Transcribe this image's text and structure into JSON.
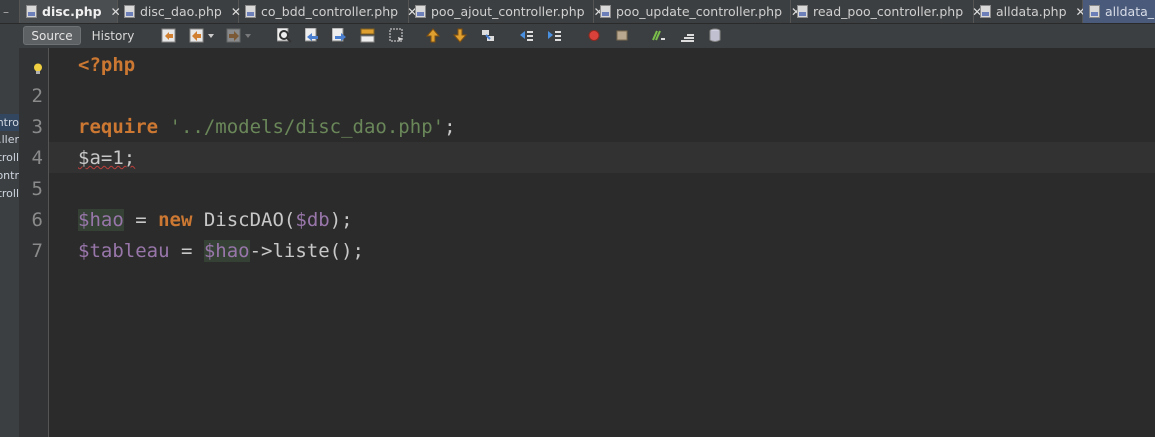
{
  "tabs": [
    {
      "label": "disc.php",
      "state": "active"
    },
    {
      "label": "disc_dao.php",
      "state": "normal"
    },
    {
      "label": "co_bdd_controller.php",
      "state": "normal"
    },
    {
      "label": "poo_ajout_controller.php",
      "state": "normal"
    },
    {
      "label": "poo_update_controller.php",
      "state": "normal"
    },
    {
      "label": "read_poo_controller.php",
      "state": "normal"
    },
    {
      "label": "alldata.php",
      "state": "normal"
    },
    {
      "label": "alldata_p",
      "state": "selected"
    }
  ],
  "tab_close_glyph": "✕",
  "tab_lead_glyph": "–",
  "toolbar": {
    "source_label": "Source",
    "history_label": "History",
    "icons": [
      "last-edit-icon",
      "back-icon",
      "forward-icon",
      "find-icon",
      "find-previous-icon",
      "find-next-icon",
      "toggle-highlight-icon",
      "toggle-rect-selection-icon",
      "previous-bookmark-icon",
      "next-bookmark-icon",
      "toggle-bookmark-icon",
      "shift-left-icon",
      "shift-right-icon",
      "start-macro-icon",
      "stop-macro-icon",
      "comment-icon",
      "uncomment-icon",
      "database-icon"
    ]
  },
  "project_tree": [
    "ntro",
    "ller.",
    "troll",
    "ontr",
    "troll"
  ],
  "editor": {
    "line_numbers": [
      "2",
      "3",
      "4",
      "5",
      "6",
      "7"
    ],
    "code": {
      "l1": "<?php",
      "l3_kw": "require",
      "l3_str": "'../models/disc_dao.php'",
      "l3_end": ";",
      "l4": "$a=1;",
      "l6_var": "$hao",
      "l6_eq": " = ",
      "l6_kw": "new",
      "l6_cls": " DiscDAO(",
      "l6_arg": "$db",
      "l6_end": ");",
      "l7_var1": "$tableau",
      "l7_eq": " = ",
      "l7_var2": "$hao",
      "l7_end": "->liste();"
    }
  },
  "colors": {
    "keyword": "#cc7832",
    "string": "#6a8759",
    "variable": "#9876aa",
    "background": "#2b2b2b"
  }
}
